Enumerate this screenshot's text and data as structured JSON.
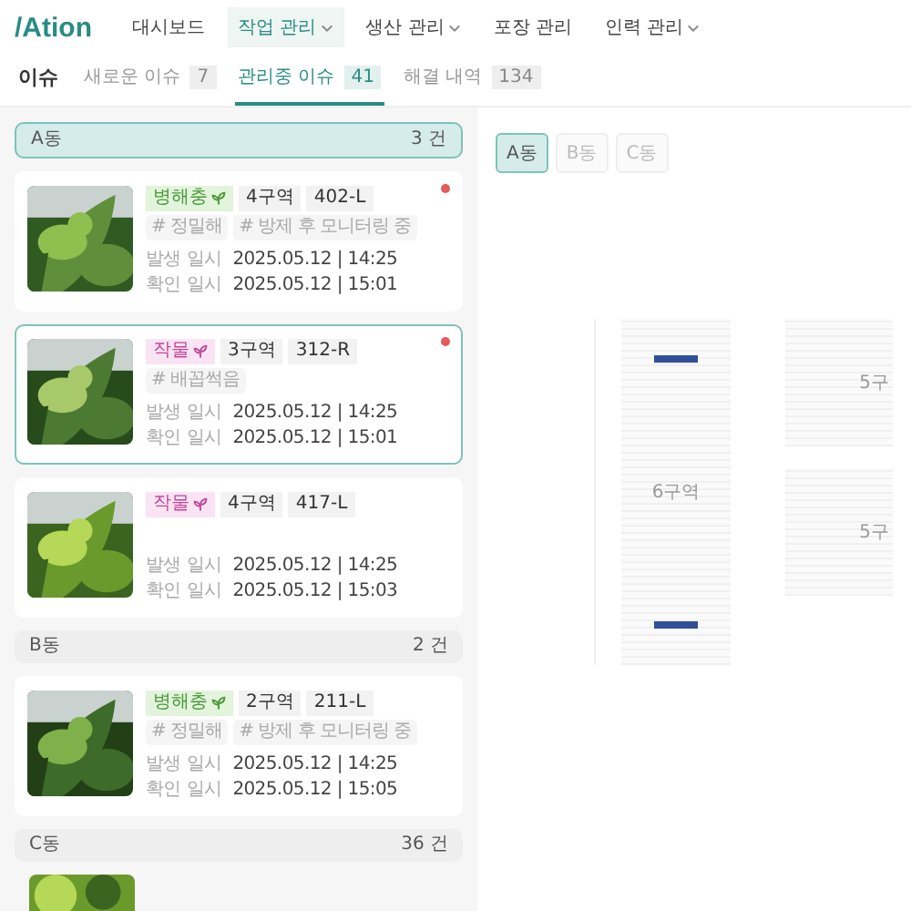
{
  "nav": {
    "logo": "/Ation",
    "items": [
      {
        "label": "대시보드",
        "dropdown": false,
        "selected": false
      },
      {
        "label": "작업 관리",
        "dropdown": true,
        "selected": true
      },
      {
        "label": "생산 관리",
        "dropdown": true,
        "selected": false
      },
      {
        "label": "포장 관리",
        "dropdown": false,
        "selected": false
      },
      {
        "label": "인력 관리",
        "dropdown": true,
        "selected": false
      }
    ]
  },
  "page": {
    "title": "이슈",
    "tabs": [
      {
        "label": "새로운 이슈",
        "count": "7",
        "selected": false
      },
      {
        "label": "관리중 이슈",
        "count": "41",
        "selected": true
      },
      {
        "label": "해결 내역",
        "count": "134",
        "selected": false
      }
    ]
  },
  "groups": [
    {
      "name": "A동",
      "count": "3 건",
      "selected": true,
      "issues": [
        {
          "category": "병해충",
          "kind": "pest",
          "zone": "4구역",
          "code": "402-L",
          "tags": [
            "# 정밀해",
            "# 방제 후 모니터링 중"
          ],
          "occurred_label": "발생 일시",
          "occurred": "2025.05.12 | 14:25",
          "confirmed_label": "확인 일시",
          "confirmed": "2025.05.12 | 15:01",
          "unread": true,
          "selected": false
        },
        {
          "category": "작물",
          "kind": "crop",
          "zone": "3구역",
          "code": "312-R",
          "tags": [
            "# 배꼽썩음"
          ],
          "occurred_label": "발생 일시",
          "occurred": "2025.05.12 | 14:25",
          "confirmed_label": "확인 일시",
          "confirmed": "2025.05.12 | 15:01",
          "unread": true,
          "selected": true
        },
        {
          "category": "작물",
          "kind": "crop",
          "zone": "4구역",
          "code": "417-L",
          "occurred_label": "발생 일시",
          "occurred": "2025.05.12 | 14:25",
          "confirmed_label": "확인 일시",
          "confirmed": "2025.05.12 | 15:03",
          "unread": false,
          "selected": false
        }
      ]
    },
    {
      "name": "B동",
      "count": "2 건",
      "selected": false,
      "issues": [
        {
          "category": "병해충",
          "kind": "pest",
          "zone": "2구역",
          "code": "211-L",
          "tags": [
            "# 정밀해",
            "# 방제 후 모니터링 중"
          ],
          "occurred_label": "발생 일시",
          "occurred": "2025.05.12 | 14:25",
          "confirmed_label": "확인 일시",
          "confirmed": "2025.05.12 | 15:05",
          "unread": false,
          "selected": false
        }
      ]
    },
    {
      "name": "C동",
      "count": "36 건",
      "selected": false
    }
  ],
  "map": {
    "buildings": [
      {
        "label": "A동",
        "selected": true
      },
      {
        "label": "B동",
        "selected": false
      },
      {
        "label": "C동",
        "selected": false
      }
    ],
    "zones": [
      {
        "label": "6구역",
        "kind": "column"
      },
      {
        "label": "5구",
        "kind": "block"
      },
      {
        "label": "5구",
        "kind": "block"
      }
    ]
  }
}
